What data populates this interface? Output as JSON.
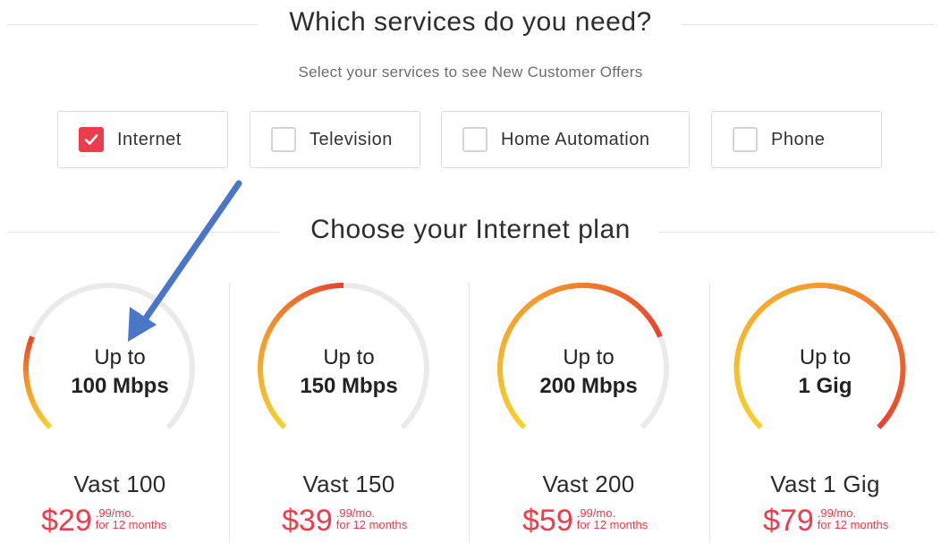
{
  "services_section": {
    "title": "Which services do you need?",
    "subtitle": "Select your services to see New Customer Offers",
    "options": [
      {
        "label": "Internet",
        "checked": true
      },
      {
        "label": "Television",
        "checked": false
      },
      {
        "label": "Home Automation",
        "checked": false
      },
      {
        "label": "Phone",
        "checked": false
      }
    ]
  },
  "plans_section": {
    "title": "Choose your Internet plan",
    "plans": [
      {
        "up_to": "Up to",
        "speed": "100 Mbps",
        "name": "Vast 100",
        "price": "$29",
        "cents": ".99/mo.",
        "term": "for 12 months",
        "gauge_level": 0.25
      },
      {
        "up_to": "Up to",
        "speed": "150 Mbps",
        "name": "Vast 150",
        "price": "$39",
        "cents": ".99/mo.",
        "term": "for 12 months",
        "gauge_level": 0.5
      },
      {
        "up_to": "Up to",
        "speed": "200 Mbps",
        "name": "Vast 200",
        "price": "$59",
        "cents": ".99/mo.",
        "term": "for 12 months",
        "gauge_level": 0.75
      },
      {
        "up_to": "Up to",
        "speed": "1 Gig",
        "name": "Vast 1 Gig",
        "price": "$79",
        "cents": ".99/mo.",
        "term": "for 12 months",
        "gauge_level": 1.0
      }
    ]
  },
  "colors": {
    "accent": "#ef3c4c",
    "gauge_start": "#f5d130",
    "gauge_mid": "#f39a2d",
    "gauge_end": "#e8432e",
    "gauge_track": "#eaeaea",
    "annotation_arrow": "#4a76c7"
  }
}
